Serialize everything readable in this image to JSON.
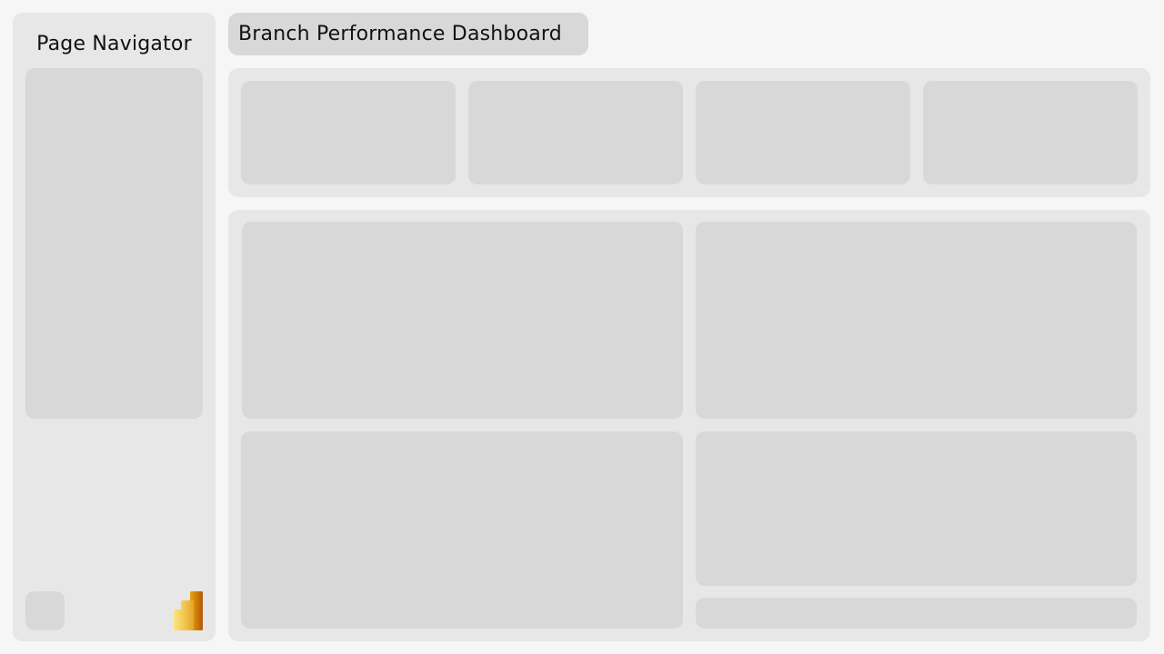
{
  "sidebar": {
    "title": "Page Navigator",
    "logo_icon": "power-bi-logo",
    "logo_colors": [
      "#f2c811",
      "#e8a10a",
      "#c46a08"
    ]
  },
  "header": {
    "title": "Branch Performance Dashboard"
  },
  "kpi_cards": [
    {
      "label": ""
    },
    {
      "label": ""
    },
    {
      "label": ""
    },
    {
      "label": ""
    }
  ],
  "visual_tiles": [
    {
      "label": ""
    },
    {
      "label": ""
    },
    {
      "label": ""
    },
    {
      "label": ""
    },
    {
      "label": ""
    }
  ],
  "colors": {
    "background": "#f6f6f6",
    "panel": "#e7e7e7",
    "placeholder": "#d8d8d8",
    "text": "#111111"
  }
}
